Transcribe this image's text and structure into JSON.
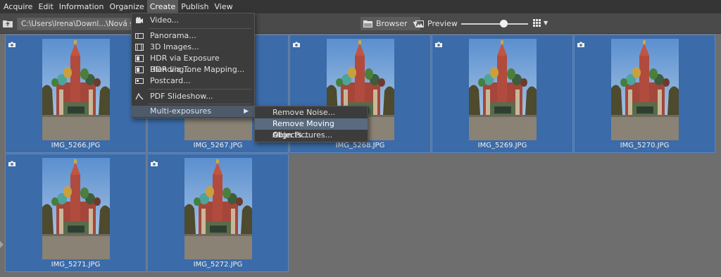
{
  "menubar": {
    "items": [
      "Acquire",
      "Edit",
      "Information",
      "Organize",
      "Create",
      "Publish",
      "View"
    ]
  },
  "toolbar": {
    "path": "C:\\Users\\Irena\\Downl...\\Nová složka",
    "browser_label": "Browser",
    "preview_label": "Preview"
  },
  "thumbnails": [
    {
      "name": "IMG_5266.JPG"
    },
    {
      "name": "IMG_5267.JPG"
    },
    {
      "name": "IMG_5268.JPG"
    },
    {
      "name": "IMG_5269.JPG"
    },
    {
      "name": "IMG_5270.JPG"
    },
    {
      "name": "IMG_5271.JPG"
    },
    {
      "name": "IMG_5272.JPG"
    }
  ],
  "create_menu": {
    "items": [
      {
        "label": "Video...",
        "icon": "video-icon"
      },
      {
        "label": "Panorama...",
        "icon": "panorama-icon"
      },
      {
        "label": "3D Images...",
        "icon": "3d-icon"
      },
      {
        "label": "HDR via Exposure Blending...",
        "icon": "hdr-icon"
      },
      {
        "label": "HDR via Tone Mapping...",
        "icon": "hdr-tone-icon"
      },
      {
        "label": "Postcard...",
        "icon": "postcard-icon"
      },
      {
        "label": "PDF Slideshow...",
        "icon": "pdf-icon"
      },
      {
        "label": "Multi-exposures",
        "icon": ""
      }
    ]
  },
  "multi_exposures_menu": {
    "items": [
      "Remove Noise...",
      "Remove Moving Objects...",
      "Align Pictures..."
    ]
  },
  "colors": {
    "selection": "#3b6ba8",
    "menubar": "#353535",
    "background": "#6e6e6e"
  }
}
